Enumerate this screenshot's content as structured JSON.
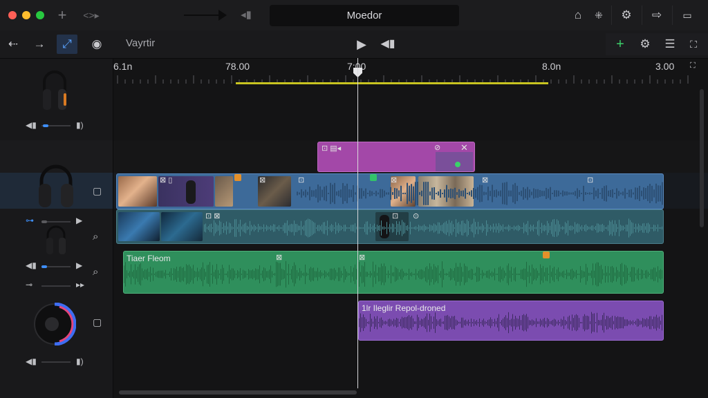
{
  "window": {
    "title": "Moedor"
  },
  "toolbar": {
    "project_name": "Vayrtir"
  },
  "ruler": {
    "labels": [
      "6.1n",
      "78.00",
      "7:00",
      "8.0n",
      "3.00"
    ]
  },
  "timeline": {
    "playhead_time": "7:00",
    "clips": {
      "title_clip": {
        "color": "#a348a8"
      },
      "video_clip": {
        "color": "#3d6a99"
      },
      "broll_clip": {
        "color": "#2f5b66"
      },
      "music_clip": {
        "label": "Tiaer Fleom",
        "color": "#2f8f5c"
      },
      "voice_clip": {
        "label": "1lr Ileglir Repol-droned",
        "color": "#7b4cb0"
      }
    }
  },
  "colors": {
    "accent": "#3e8ef7",
    "range_bar": "#c8c420",
    "marker_orange": "#e4902a",
    "marker_green": "#33c36a"
  },
  "icons": {
    "title_left": [
      "plus-icon",
      "code-icon"
    ],
    "title_right": [
      "home-icon",
      "grid-icon",
      "gear-icon",
      "export-icon",
      "panel-icon"
    ],
    "tools": [
      "back-icon",
      "forward-icon",
      "select-icon",
      "clock-icon"
    ],
    "transport": [
      "play-icon",
      "volume-icon"
    ],
    "right_tools": [
      "add-icon",
      "settings-icon",
      "list-icon",
      "fullscreen-icon"
    ]
  }
}
